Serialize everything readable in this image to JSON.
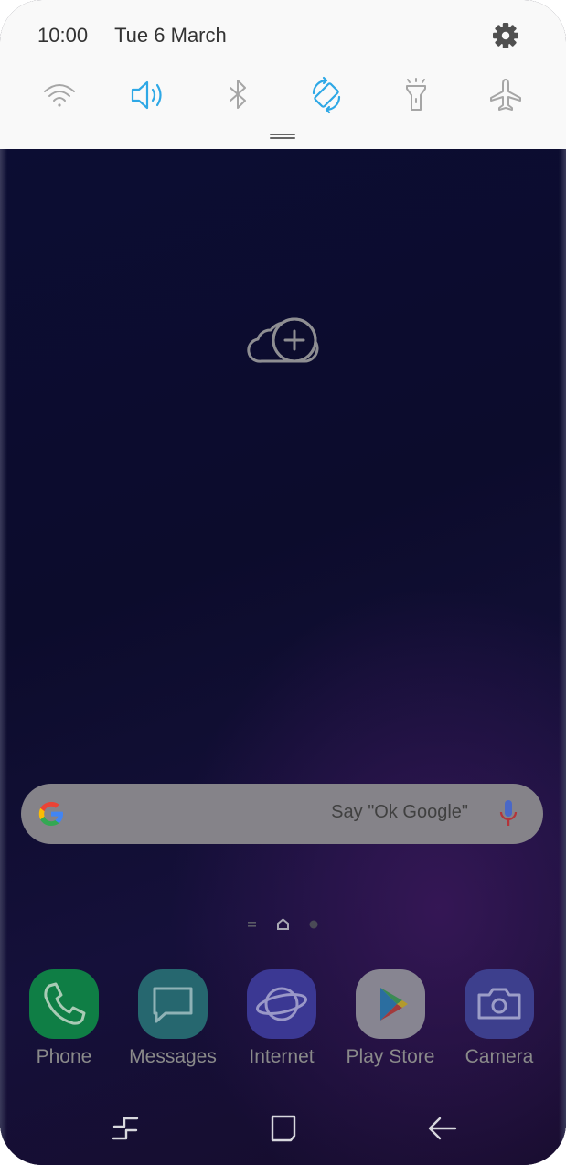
{
  "status": {
    "time": "10:00",
    "date": "Tue 6 March",
    "settings_icon": "gear-icon"
  },
  "quick_settings": [
    {
      "name": "wifi-icon",
      "state": "off"
    },
    {
      "name": "sound-icon",
      "state": "on"
    },
    {
      "name": "bluetooth-icon",
      "state": "off"
    },
    {
      "name": "auto-rotate-icon",
      "state": "on"
    },
    {
      "name": "flashlight-icon",
      "state": "off"
    },
    {
      "name": "airplane-icon",
      "state": "off"
    }
  ],
  "colors": {
    "active": "#2ea8e6",
    "inactive": "#9e9e9e",
    "panel_bg": "#f9f9f9"
  },
  "home": {
    "add_widget_icon": "cloud-plus-icon",
    "search": {
      "placeholder": "Say \"Ok Google\"",
      "logo": "google-g-icon",
      "mic": "mic-icon"
    },
    "page_indicator": [
      "menu-lines-icon",
      "home-page-icon",
      "page-dot-icon"
    ],
    "current_page": 2
  },
  "dock": [
    {
      "label": "Phone",
      "icon": "phone-icon",
      "color": "#0f7e45"
    },
    {
      "label": "Messages",
      "icon": "messages-icon",
      "color": "#26676f"
    },
    {
      "label": "Internet",
      "icon": "internet-icon",
      "color": "#3b3893"
    },
    {
      "label": "Play Store",
      "icon": "play-store-icon",
      "color": "#878591"
    },
    {
      "label": "Camera",
      "icon": "camera-icon",
      "color": "#3d3f8d"
    }
  ],
  "navigation": [
    "recents-icon",
    "home-icon",
    "back-icon"
  ]
}
